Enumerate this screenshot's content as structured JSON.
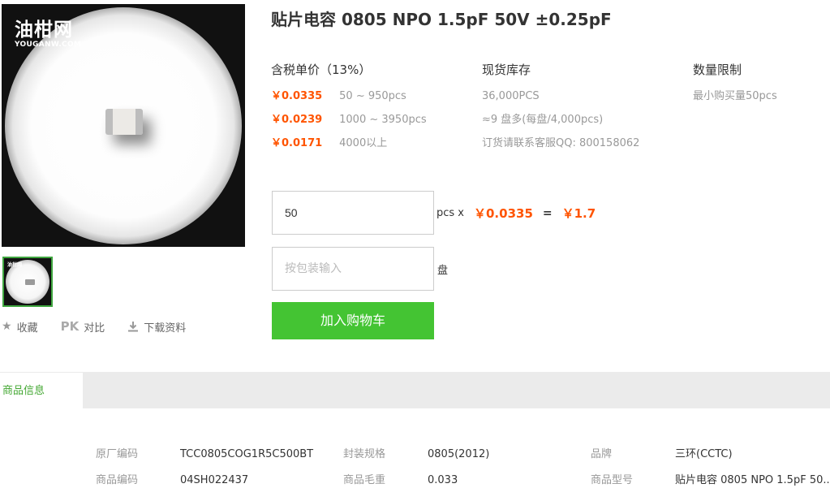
{
  "product": {
    "title": "贴片电容 0805 NPO 1.5pF 50V ±0.25pF",
    "watermark_cn": "油柑网",
    "watermark_en": "YOUGANW.COM",
    "thumb_watermark": "油柑网"
  },
  "actions": {
    "favorite": "收藏",
    "compare_icon": "PK",
    "compare": "对比",
    "download": "下载资料"
  },
  "pricing": {
    "header": "含税单价（13%）",
    "tiers": [
      {
        "price": "￥0.0335",
        "range": "50 ~ 950pcs"
      },
      {
        "price": "￥0.0239",
        "range": "1000 ~ 3950pcs"
      },
      {
        "price": "￥0.0171",
        "range": "4000以上"
      }
    ]
  },
  "stock": {
    "header": "现货库存",
    "lines": [
      "36,000PCS",
      "≈9 盘多(每盘/4,000pcs)",
      "订货请联系客服QQ: 800158062"
    ]
  },
  "limit": {
    "header": "数量限制",
    "lines": [
      "最小购买量50pcs"
    ]
  },
  "order": {
    "quantity_value": "50",
    "unit_label": "pcs x",
    "unit_price": "￥0.0335",
    "equals": "=",
    "total": "￥1.7",
    "reel_placeholder": "按包装输入",
    "reel_unit": "盘",
    "add_to_cart": "加入购物车"
  },
  "tabs": {
    "info": "商品信息"
  },
  "specs": {
    "row1": [
      {
        "key": "原厂编码",
        "value": "TCC0805COG1R5C500BT"
      },
      {
        "key": "封装规格",
        "value": "0805(2012)"
      },
      {
        "key": "品牌",
        "value": "三环(CCTC)"
      }
    ],
    "row2": [
      {
        "key": "商品编码",
        "value": "04SH022437"
      },
      {
        "key": "商品毛重",
        "value": "0.033"
      },
      {
        "key": "商品型号",
        "value": "贴片电容 0805 NPO 1.5pF 50..."
      }
    ]
  },
  "colors": {
    "price": "#ff5400",
    "cart_button": "#44c433",
    "tab_active_text": "#44a833"
  },
  "icons": [
    "star-icon",
    "pk-icon",
    "download-icon"
  ]
}
